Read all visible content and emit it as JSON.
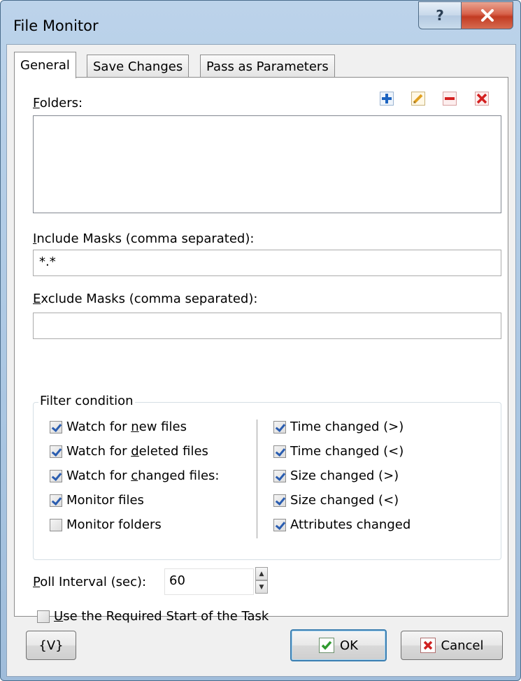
{
  "window": {
    "title": "File Monitor",
    "help_label": "?",
    "close_label": "x"
  },
  "tabs": [
    {
      "label": "General"
    },
    {
      "label": "Save Changes"
    },
    {
      "label": "Pass as Parameters"
    }
  ],
  "folders": {
    "label_first": "F",
    "label_rest": "olders:",
    "toolbar": [
      "add-icon",
      "edit-icon",
      "remove-icon",
      "delete-icon"
    ]
  },
  "include": {
    "label_first": "I",
    "label_rest": "nclude Masks (comma separated):",
    "value": "*.*"
  },
  "exclude": {
    "label_first": "E",
    "label_rest": "xclude Masks (comma separated):",
    "value": ""
  },
  "filter": {
    "title": "Filter condition",
    "left": [
      {
        "pre": "Watch for ",
        "key": "n",
        "post": "ew files",
        "checked": true
      },
      {
        "pre": "Watch for ",
        "key": "d",
        "post": "eleted files",
        "checked": true
      },
      {
        "pre": "Watch for ",
        "key": "c",
        "post": "hanged files:",
        "checked": true
      },
      {
        "pre": "Monitor files",
        "key": "",
        "post": "",
        "checked": true
      },
      {
        "pre": "Monitor folders",
        "key": "",
        "post": "",
        "checked": false
      }
    ],
    "right": [
      {
        "label": "Time changed (>)",
        "checked": true
      },
      {
        "label": "Time changed (<)",
        "checked": true
      },
      {
        "label": "Size changed (>)",
        "checked": true
      },
      {
        "label": "Size changed (<)",
        "checked": true
      },
      {
        "label": "Attributes changed",
        "checked": true
      }
    ]
  },
  "poll": {
    "label_first": "P",
    "label_rest": "oll Interval (sec):",
    "value": "60"
  },
  "required_start": {
    "label_first": "U",
    "label_rest": "se the Required Start of the Task",
    "checked": false
  },
  "buttons": {
    "variables": "{V}",
    "ok": "OK",
    "cancel": "Cancel"
  },
  "colors": {
    "accent": "#3c7fb1",
    "ok_check": "#2f9a2f",
    "cancel_x": "#d02020",
    "add": "#1c63c0",
    "remove": "#d42020"
  }
}
